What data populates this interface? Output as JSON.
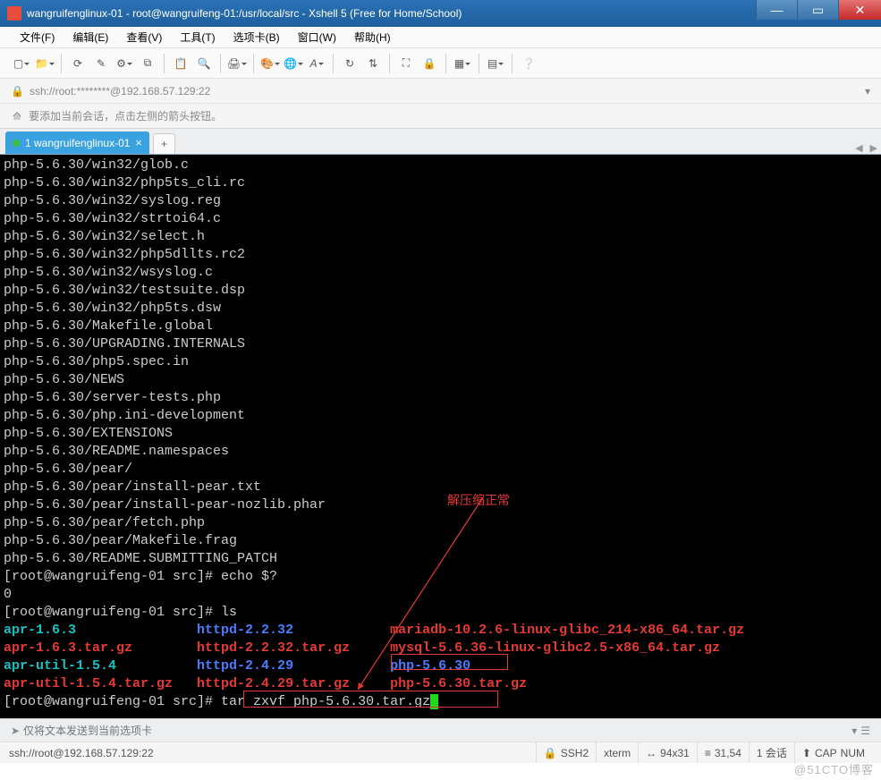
{
  "window": {
    "title": "wangruifenglinux-01 - root@wangruifeng-01:/usr/local/src - Xshell 5 (Free for Home/School)"
  },
  "menu": {
    "items": [
      "文件(F)",
      "编辑(E)",
      "查看(V)",
      "工具(T)",
      "选项卡(B)",
      "窗口(W)",
      "帮助(H)"
    ]
  },
  "address": "ssh://root:********@192.168.57.129:22",
  "tip": "要添加当前会话，点击左侧的箭头按钮。",
  "tab": {
    "label": "1 wangruifenglinux-01"
  },
  "sendbar": {
    "placeholder": "仅将文本发送到当前选项卡"
  },
  "status": {
    "conn": "ssh://root@192.168.57.129:22",
    "proto": "SSH2",
    "term": "xterm",
    "size": "94x31",
    "pos": "31,54",
    "sess": "1 会话",
    "caps": "CAP",
    "num": "NUM"
  },
  "annotation": "解压缩正常",
  "terminal": {
    "lines": [
      {
        "t": "php-5.6.30/win32/glob.c",
        "c": "w"
      },
      {
        "t": "php-5.6.30/win32/php5ts_cli.rc",
        "c": "w"
      },
      {
        "t": "php-5.6.30/win32/syslog.reg",
        "c": "w"
      },
      {
        "t": "php-5.6.30/win32/strtoi64.c",
        "c": "w"
      },
      {
        "t": "php-5.6.30/win32/select.h",
        "c": "w"
      },
      {
        "t": "php-5.6.30/win32/php5dllts.rc2",
        "c": "w"
      },
      {
        "t": "php-5.6.30/win32/wsyslog.c",
        "c": "w"
      },
      {
        "t": "php-5.6.30/win32/testsuite.dsp",
        "c": "w"
      },
      {
        "t": "php-5.6.30/win32/php5ts.dsw",
        "c": "w"
      },
      {
        "t": "php-5.6.30/Makefile.global",
        "c": "w"
      },
      {
        "t": "php-5.6.30/UPGRADING.INTERNALS",
        "c": "w"
      },
      {
        "t": "php-5.6.30/php5.spec.in",
        "c": "w"
      },
      {
        "t": "php-5.6.30/NEWS",
        "c": "w"
      },
      {
        "t": "php-5.6.30/server-tests.php",
        "c": "w"
      },
      {
        "t": "php-5.6.30/php.ini-development",
        "c": "w"
      },
      {
        "t": "php-5.6.30/EXTENSIONS",
        "c": "w"
      },
      {
        "t": "php-5.6.30/README.namespaces",
        "c": "w"
      },
      {
        "t": "php-5.6.30/pear/",
        "c": "w"
      },
      {
        "t": "php-5.6.30/pear/install-pear.txt",
        "c": "w"
      },
      {
        "t": "php-5.6.30/pear/install-pear-nozlib.phar",
        "c": "w"
      },
      {
        "t": "php-5.6.30/pear/fetch.php",
        "c": "w"
      },
      {
        "t": "php-5.6.30/pear/Makefile.frag",
        "c": "w"
      },
      {
        "t": "php-5.6.30/README.SUBMITTING_PATCH",
        "c": "w"
      }
    ],
    "prompt1": "[root@wangruifeng-01 src]# echo $?",
    "echo_result": "0",
    "prompt2": "[root@wangruifeng-01 src]# ls",
    "ls_rows": [
      [
        {
          "t": "apr-1.6.3",
          "c": "cy"
        },
        {
          "t": "httpd-2.2.32",
          "c": "bl"
        },
        {
          "t": "mariadb-10.2.6-linux-glibc_214-x86_64.tar.gz",
          "c": "rd"
        }
      ],
      [
        {
          "t": "apr-1.6.3.tar.gz",
          "c": "rd"
        },
        {
          "t": "httpd-2.2.32.tar.gz",
          "c": "rd"
        },
        {
          "t": "mysql-5.6.36-linux-glibc2.5-x86_64.tar.gz",
          "c": "rd"
        }
      ],
      [
        {
          "t": "apr-util-1.5.4",
          "c": "cy"
        },
        {
          "t": "httpd-2.4.29",
          "c": "bl"
        },
        {
          "t": "php-5.6.30",
          "c": "bl"
        }
      ],
      [
        {
          "t": "apr-util-1.5.4.tar.gz",
          "c": "rd"
        },
        {
          "t": "httpd-2.4.29.tar.gz",
          "c": "rd"
        },
        {
          "t": "php-5.6.30.tar.gz",
          "c": "rd"
        }
      ]
    ],
    "prompt3_pre": "[root@wangruifeng-01 src]# ",
    "prompt3_cmd": "tar zxvf php-5.6.30.tar.gz"
  },
  "watermark": "@51CTO博客"
}
